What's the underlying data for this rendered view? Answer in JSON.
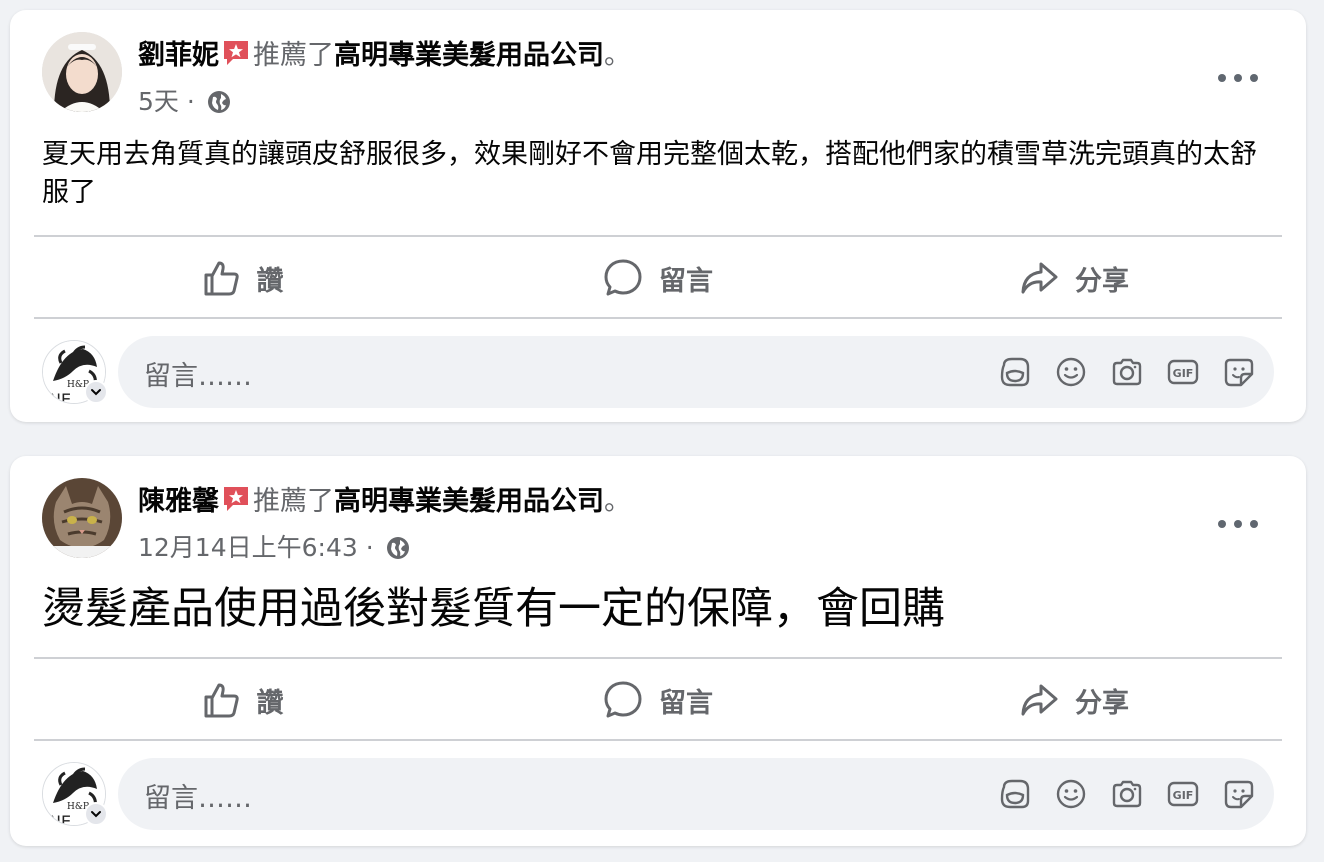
{
  "posts": [
    {
      "author": "劉菲妮",
      "verb": "推薦了",
      "page": "高明專業美髮用品公司",
      "end": "。",
      "time": "5天",
      "sep": "·",
      "body": "夏天用去角質真的讓頭皮舒服很多，效果剛好不會用完整個太乾，搭配他們家的積雪草洗完頭真的太舒服了"
    },
    {
      "author": "陳雅馨",
      "verb": "推薦了",
      "page": "高明專業美髮用品公司",
      "end": "。",
      "time": "12月14日上午6:43",
      "sep": "·",
      "body": "燙髮產品使用過後對髮質有一定的保障，會回購"
    }
  ],
  "actions": {
    "like": "讚",
    "comment": "留言",
    "share": "分享"
  },
  "composer": {
    "placeholder": "留言……"
  },
  "icons": {
    "recommend_badge": "star-tag-icon",
    "audience": "globe-icon",
    "like": "thumbs-up-icon",
    "comment": "speech-bubble-icon",
    "share": "share-arrow-icon",
    "tools": [
      "avatar-sticker-icon",
      "emoji-icon",
      "camera-icon",
      "gif-icon",
      "sticker-icon"
    ]
  },
  "colors": {
    "badge": "#e0505a",
    "secondary_text": "#65676b",
    "card": "#ffffff",
    "background": "#f0f2f5"
  }
}
